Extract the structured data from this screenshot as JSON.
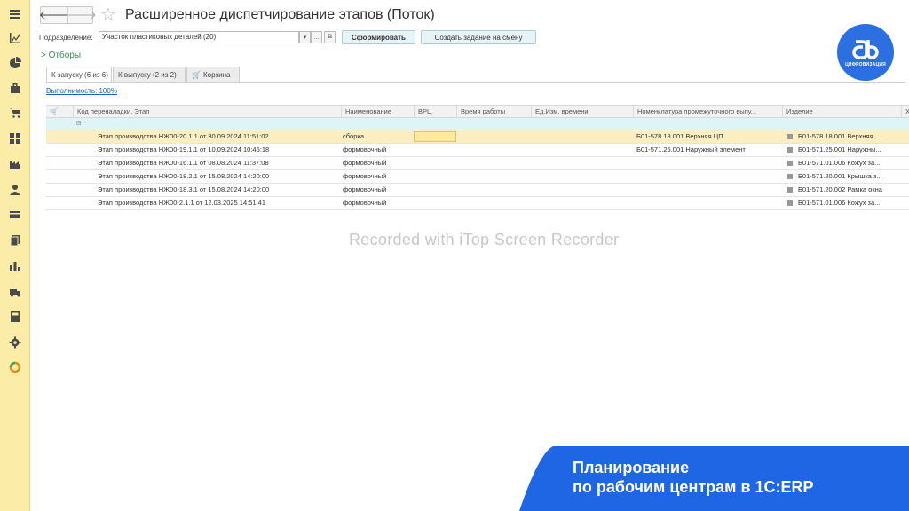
{
  "window": {
    "title": "Расширенное диспетчирование этапов (Поток)",
    "nav_back": "🡐",
    "nav_forward": "🡒",
    "star": "☆"
  },
  "sidebar": {
    "items": [
      {
        "icon": "menu-icon"
      },
      {
        "icon": "chart-line-icon"
      },
      {
        "icon": "pie-chart-icon"
      },
      {
        "icon": "bag-icon"
      },
      {
        "icon": "cart-icon"
      },
      {
        "icon": "grid-icon"
      },
      {
        "icon": "factory-icon"
      },
      {
        "icon": "user-icon"
      },
      {
        "icon": "card-icon"
      },
      {
        "icon": "documents-icon"
      },
      {
        "icon": "bar-chart-icon"
      },
      {
        "icon": "truck-icon"
      },
      {
        "icon": "calculator-icon"
      },
      {
        "icon": "gear-icon"
      },
      {
        "icon": "ring-icon"
      }
    ]
  },
  "filter": {
    "label": "Подразделение:",
    "value": "Участок пластиковых деталей (20)",
    "dropdown_glyph": "▾",
    "select_glyph": "...",
    "open_glyph": "⧉",
    "form_button": "Сформировать",
    "create_button": "Создать задание на смену"
  },
  "filters_toggle": "> Отборы",
  "tabs": [
    {
      "label": "К запуску (6 из 6)",
      "active": true
    },
    {
      "label": "К выпуску (2 из 2)",
      "active": false
    },
    {
      "label": "Корзина",
      "active": false
    }
  ],
  "completion_link": "Выполнимость: 100%",
  "table": {
    "headers": {
      "basket": "🛒",
      "code": "Код переналадки, Этап",
      "name": "Наименование",
      "vrc": "ВРЦ",
      "worktime": "Время работы",
      "unit": "Ед.Изм. времени",
      "nomen": "Номенклатура промежуточного выпу...",
      "product": "Изделие",
      "extra": "Х"
    },
    "group_row_mark": "⊟",
    "rows": [
      {
        "stage": "Этап производства НЖ00-20.1.1 от 30.09.2024 11:51:02",
        "name": "сборка",
        "nomen": "Б01-578.18.001 Верхняя ЦП",
        "product": "Б01-578.18.001 Верхняя ...",
        "selected": true
      },
      {
        "stage": "Этап производства НЖ00-19.1.1 от 10.09.2024 10:45:18",
        "name": "формовочный",
        "nomen": "Б01-571.25.001 Наружный элемент",
        "product": "Б01-571.25.001 Наружны...",
        "selected": false
      },
      {
        "stage": "Этап производства НЖ00-16.1.1 от 08.08.2024 11:37:08",
        "name": "формовочный",
        "nomen": "",
        "product": "Б01-571.01.006 Кожух за...",
        "selected": false
      },
      {
        "stage": "Этап производства НЖ00-18.2.1 от 15.08.2024 14:20:00",
        "name": "формовочный",
        "nomen": "",
        "product": "Б01-571.20.001 Крышка з...",
        "selected": false
      },
      {
        "stage": "Этап производства НЖ00-18.3.1 от 15.08.2024 14:20:00",
        "name": "формовочный",
        "nomen": "",
        "product": "Б01-571.20.002 Рамка окна",
        "selected": false
      },
      {
        "stage": "Этап производства НЖ00-2.1.1 от 12.03.2025 14:51:41",
        "name": "формовочный",
        "nomen": "",
        "product": "Б01-571.01.006 Кожух за...",
        "selected": false
      }
    ]
  },
  "watermark": "Recorded with iTop Screen Recorder",
  "logo": {
    "caption": "ЦИФРОВИЗАЦИЯ"
  },
  "banner": {
    "line1": "Планирование",
    "line2": "по рабочим центрам в 1С:ERP",
    "color": "#1f66e5"
  }
}
